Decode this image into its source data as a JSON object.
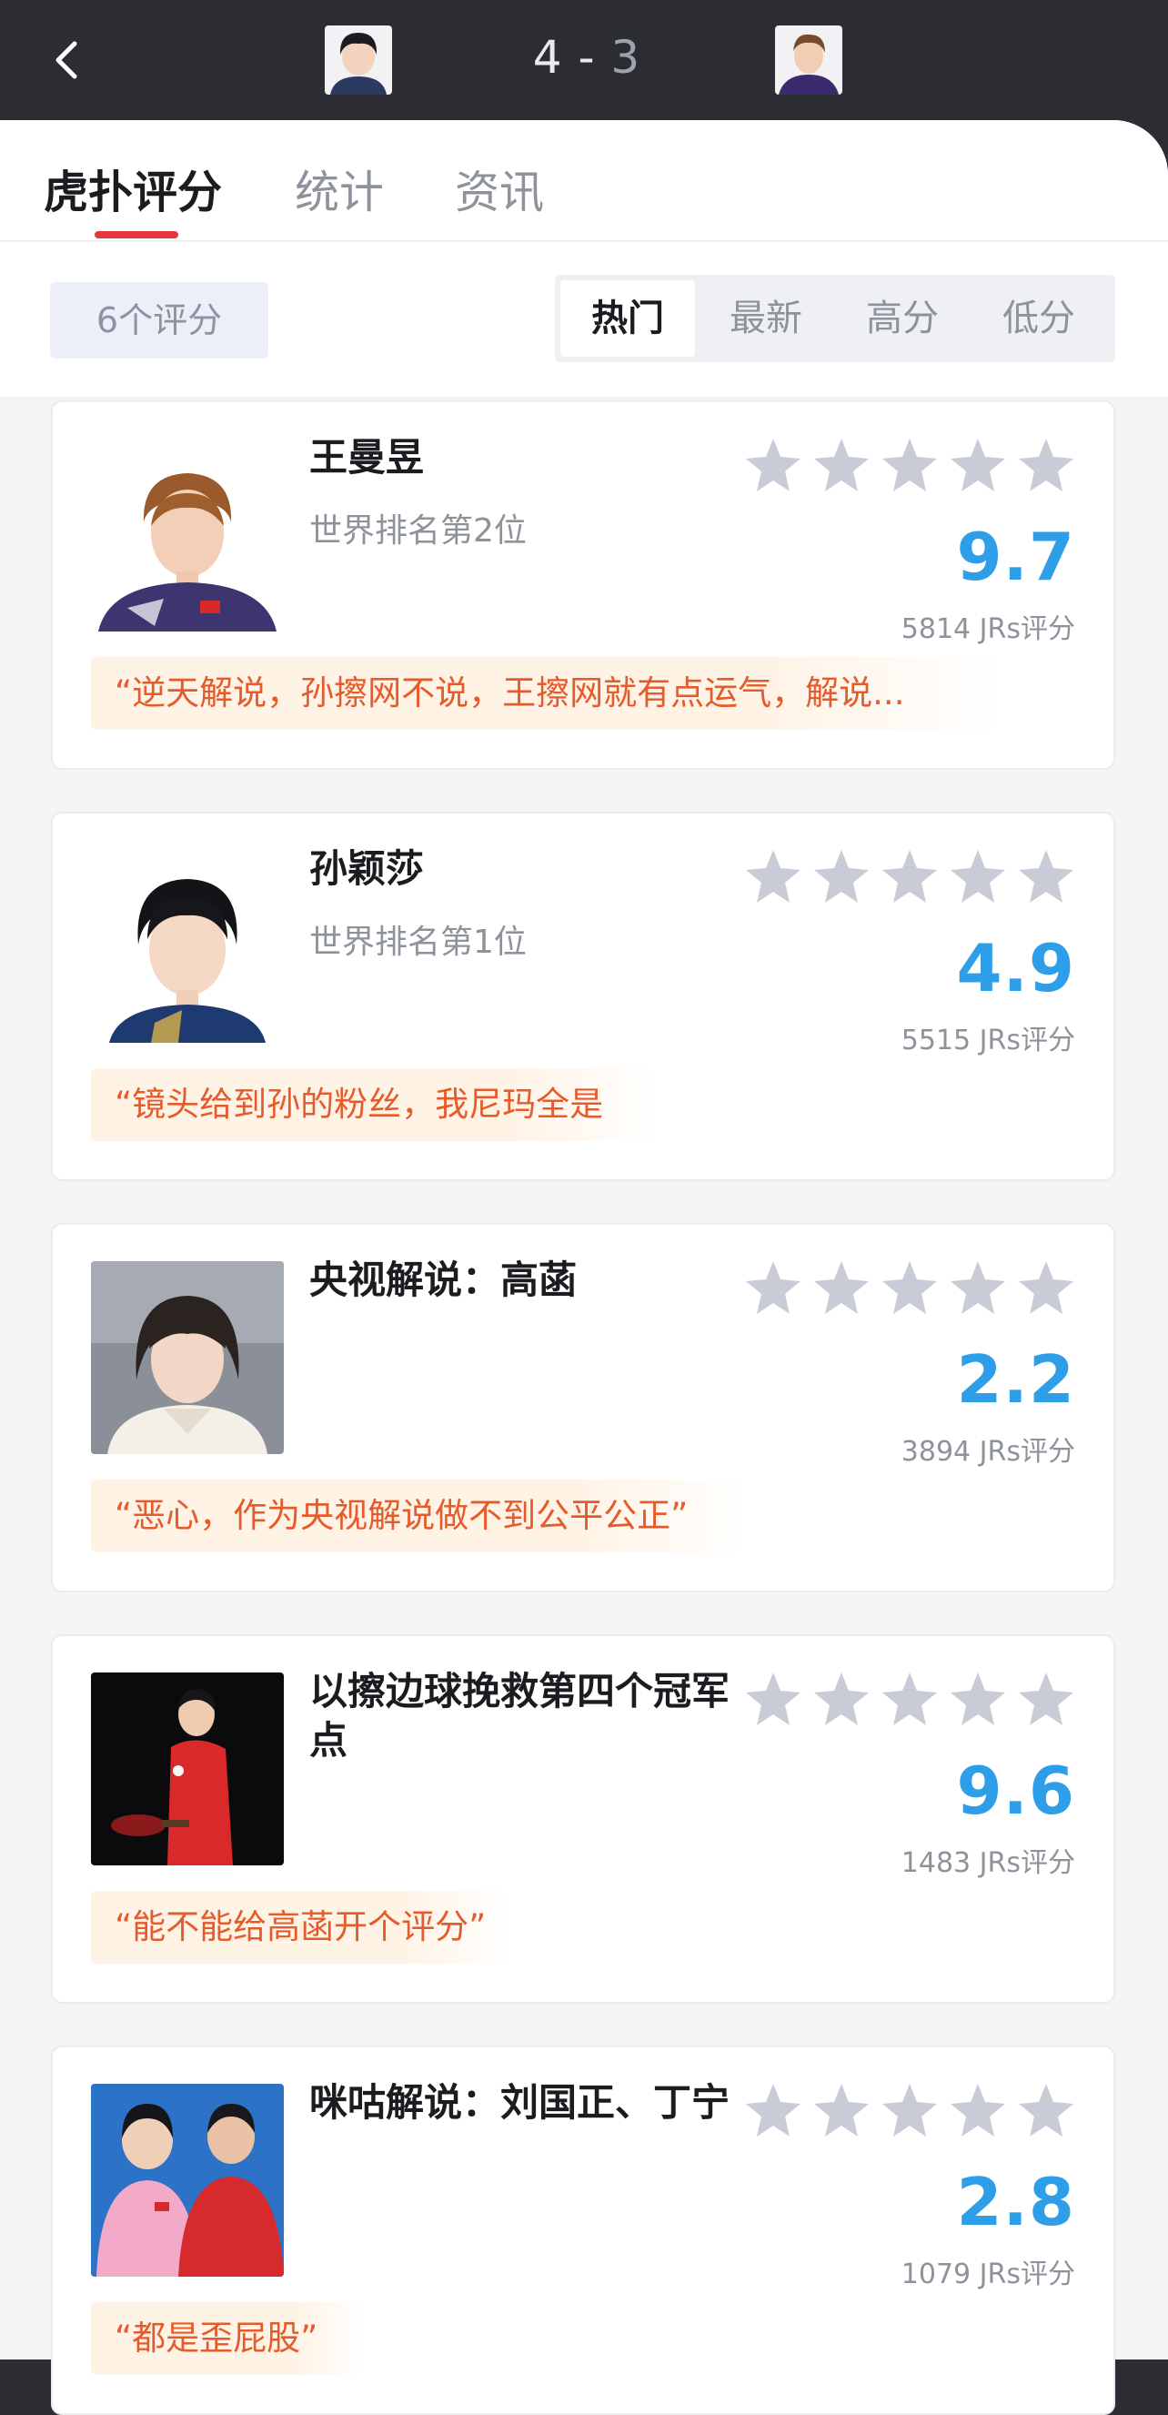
{
  "header": {
    "score_home": "4",
    "score_sep": " - ",
    "score_away": "3"
  },
  "tabs": [
    {
      "label": "虎扑评分",
      "active": true
    },
    {
      "label": "统计",
      "active": false
    },
    {
      "label": "资讯",
      "active": false
    }
  ],
  "filter": {
    "count_label": "6个评分",
    "segments": [
      "热门",
      "最新",
      "高分",
      "低分"
    ],
    "active_segment": "热门"
  },
  "colors": {
    "accent_red": "#e4393c",
    "score_blue": "#2f9ee8",
    "quote_orange": "#e55b2b",
    "star_gray": "#c9ccd6"
  },
  "cards": [
    {
      "name": "王曼昱",
      "subtitle": "世界排名第2位",
      "score": "9.7",
      "rating_count": "5814 JRs评分",
      "quote": "“逆天解说，孙擦网不说，王擦网就有点运气，解说...",
      "quote_width": 1000
    },
    {
      "name": "孙颖莎",
      "subtitle": "世界排名第1位",
      "score": "4.9",
      "rating_count": "5515 JRs评分",
      "quote": "“镜头给到孙的粉丝，我尼玛全是",
      "quote_width": 620
    },
    {
      "name": "央视解说：高菡",
      "subtitle": "",
      "score": "2.2",
      "rating_count": "3894 JRs评分",
      "quote": "“恶心，作为央视解说做不到公平公正”",
      "quote_width": 720
    },
    {
      "name": "以擦边球挽救第四个冠军点",
      "subtitle": "",
      "score": "9.6",
      "rating_count": "1483 JRs评分",
      "quote": "“能不能给高菡开个评分”",
      "quote_width": 460
    },
    {
      "name": "咪咕解说：刘国正、丁宁",
      "subtitle": "",
      "score": "2.8",
      "rating_count": "1079 JRs评分",
      "quote": "“都是歪屁股”",
      "quote_width": 300
    }
  ]
}
